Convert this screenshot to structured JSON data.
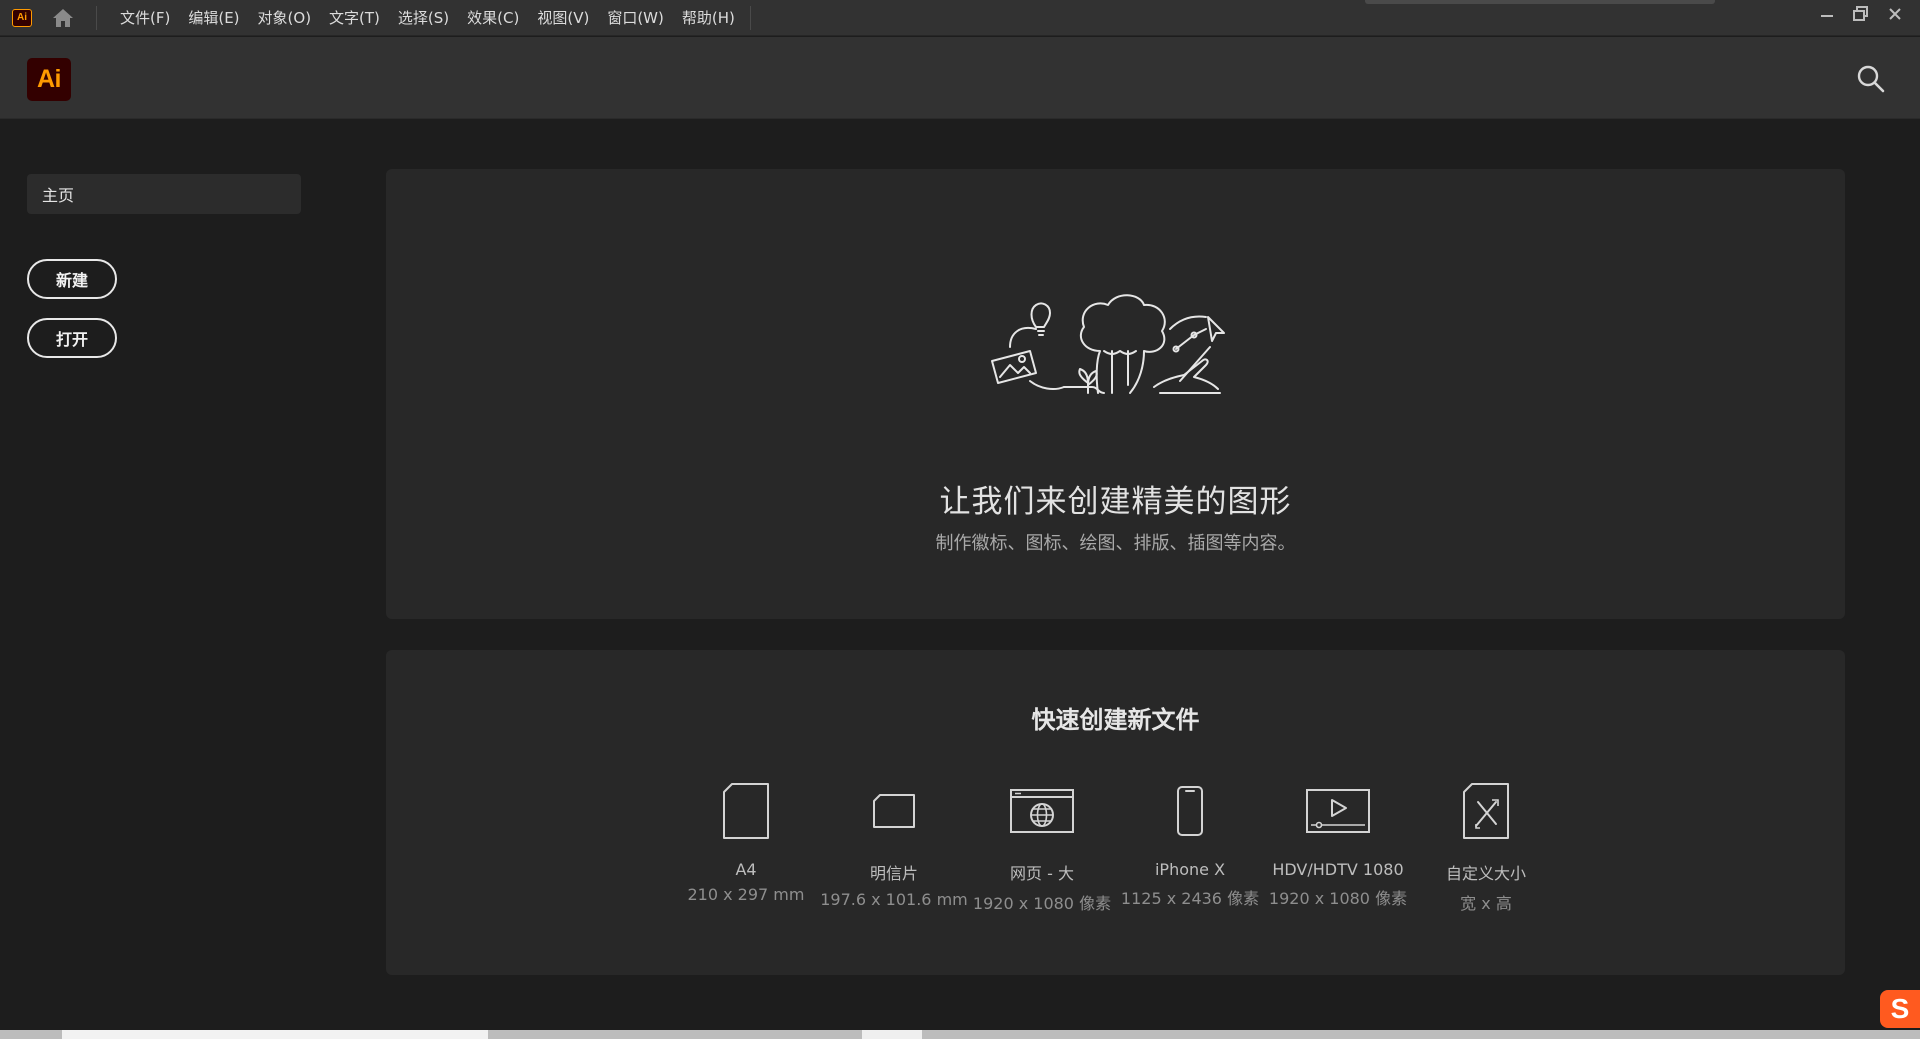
{
  "menubar": {
    "app_icon_text": "Ai",
    "items": [
      "文件(F)",
      "编辑(E)",
      "对象(O)",
      "文字(T)",
      "选择(S)",
      "效果(C)",
      "视图(V)",
      "窗口(W)",
      "帮助(H)"
    ]
  },
  "header": {
    "logo_text": "Ai",
    "brand_color": "#ff9a00",
    "logo_bg": "#330000"
  },
  "sidebar": {
    "home_label": "主页",
    "new_label": "新建",
    "open_label": "打开"
  },
  "hero": {
    "title": "让我们来创建精美的图形",
    "subtitle": "制作徽标、图标、绘图、排版、插图等内容。"
  },
  "quick_create": {
    "title": "快速创建新文件",
    "presets": [
      {
        "name": "A4",
        "size": "210 x 297 mm",
        "icon": "document-icon"
      },
      {
        "name": "明信片",
        "size": "197.6 x 101.6 mm",
        "icon": "postcard-icon"
      },
      {
        "name": "网页 - 大",
        "size": "1920 x 1080 像素",
        "icon": "web-icon"
      },
      {
        "name": "iPhone X",
        "size": "1125 x 2436 像素",
        "icon": "phone-icon"
      },
      {
        "name": "HDV/HDTV 1080",
        "size": "1920 x 1080 像素",
        "icon": "video-icon"
      },
      {
        "name": "自定义大小",
        "size": "宽 x 高",
        "icon": "custom-size-icon"
      }
    ]
  }
}
